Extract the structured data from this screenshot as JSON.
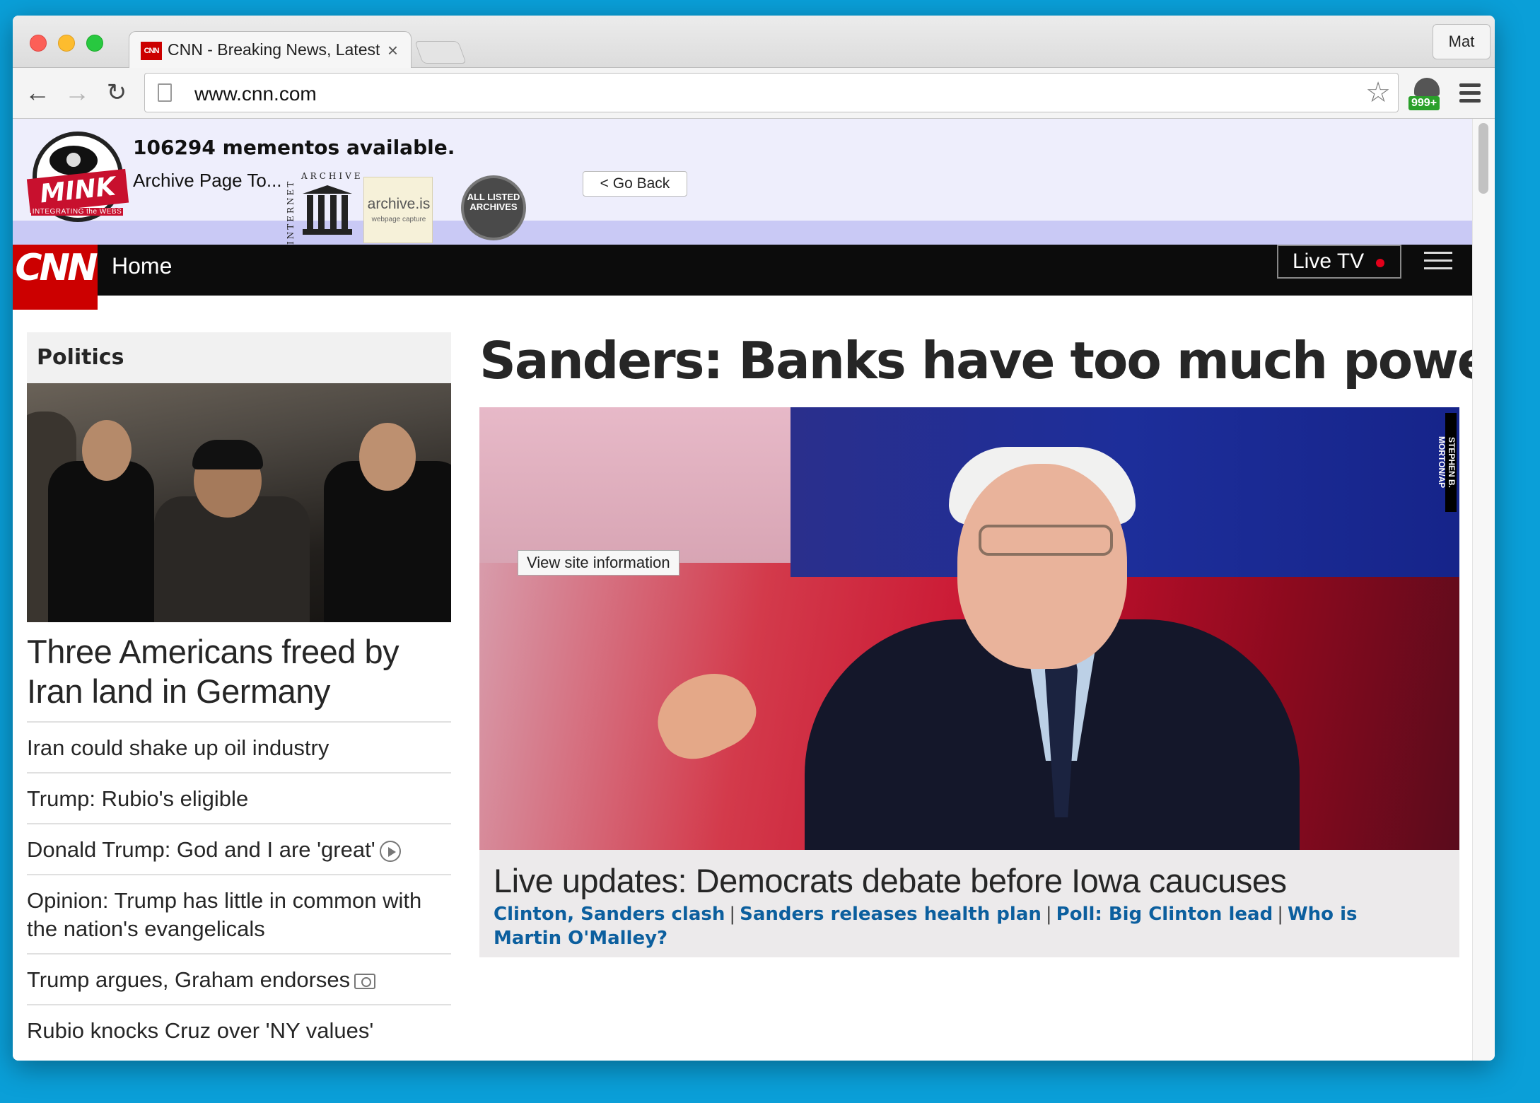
{
  "browser": {
    "tab_title": "CNN - Breaking News, Latest",
    "tab_favicon": "CNN",
    "tab_close": "×",
    "profile_name": "Mat",
    "url": "www.cnn.com",
    "extension_badge": "999+",
    "star_icon": "☆"
  },
  "mink": {
    "logo_word": "MINK",
    "logo_tagline": "INTEGRATING the WEBS",
    "mementos_text": "106294 mementos available.",
    "archive_label": "Archive Page To...",
    "ia_top": "ARCHIVE",
    "ia_side": "INTERNET",
    "archive_is_name": "archive.is",
    "archive_is_sub": "webpage capture",
    "all_archives": "ALL LISTED ARCHIVES",
    "go_back": "< Go Back"
  },
  "cnn_nav": {
    "logo": "CNN",
    "home": "Home",
    "live_tv": "Live TV"
  },
  "politics": {
    "section": "Politics",
    "lead_headline": "Three Americans freed by Iran land in Germany",
    "stories": [
      "Iran could shake up oil industry",
      "Trump: Rubio's eligible",
      "Donald Trump: God and I are 'great'",
      "Opinion: Trump has little in common with the nation's evangelicals",
      "Trump argues, Graham endorses",
      "Rubio knocks Cruz over 'NY values'"
    ]
  },
  "main": {
    "headline": "Sanders: Banks have too much power",
    "photo_credit": "STEPHEN B. MORTON/AP",
    "tooltip": "View site information",
    "caption_title": "Live updates: Democrats debate before Iowa caucuses",
    "caption_links": [
      "Clinton, Sanders clash",
      "Sanders releases health plan",
      "Poll: Big Clinton lead",
      "Who is Martin O'Malley?"
    ]
  },
  "colors": {
    "cnn_red": "#cc0000",
    "link_blue": "#0c5f9e",
    "mink_bar": "#eeeefc"
  }
}
